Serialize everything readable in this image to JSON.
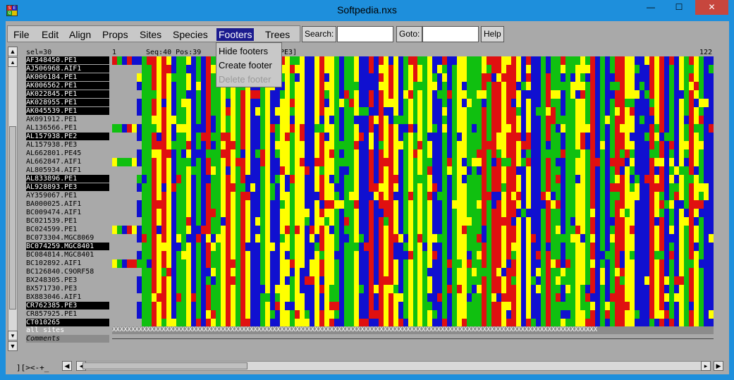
{
  "window": {
    "title": "Softpedia.nxs",
    "minimize": "—",
    "maximize": "☐",
    "close": "✕"
  },
  "app_icon_letters": [
    "S",
    "E",
    "Q",
    ""
  ],
  "menubar": [
    "File",
    "Edit",
    "Align",
    "Props",
    "Sites",
    "Species",
    "Footers",
    "Trees"
  ],
  "toolbar": {
    "search_label": "Search:",
    "search_value": "",
    "goto_label": "Goto:",
    "goto_value": "",
    "help_label": "Help"
  },
  "footers_menu": {
    "items": [
      {
        "label": "Hide footers",
        "enabled": true
      },
      {
        "label": "Create footer",
        "enabled": true
      },
      {
        "label": "Delete footer",
        "enabled": false
      }
    ]
  },
  "header": {
    "sel": "sel=30",
    "start": "1",
    "seq_pos": "Seq:40 Pos:39",
    "tail": "PE3]",
    "end": "122"
  },
  "sequences": [
    {
      "name": "AF348450.PE1",
      "selected": true
    },
    {
      "name": "AJ506968.AIF1",
      "selected": true
    },
    {
      "name": "AK006184.PE1",
      "selected": true
    },
    {
      "name": "AK006562.PE1",
      "selected": true
    },
    {
      "name": "AK022845.PE1",
      "selected": true
    },
    {
      "name": "AK028955.PE1",
      "selected": true
    },
    {
      "name": "AK045539.PE1",
      "selected": true
    },
    {
      "name": "AK091912.PE1",
      "selected": false
    },
    {
      "name": "AL136566.PE1",
      "selected": false
    },
    {
      "name": "AL157938.PE2",
      "selected": true
    },
    {
      "name": "AL157938.PE3",
      "selected": false
    },
    {
      "name": "AL662801.PE45",
      "selected": false
    },
    {
      "name": "AL662847.AIF1",
      "selected": false
    },
    {
      "name": "AL805934.AIF1",
      "selected": false
    },
    {
      "name": "AL833896.PE1",
      "selected": true
    },
    {
      "name": "AL928893.PE3",
      "selected": true
    },
    {
      "name": "AY359067.PE1",
      "selected": false
    },
    {
      "name": "BA000025.AIF1",
      "selected": false
    },
    {
      "name": "BC009474.AIF1",
      "selected": false
    },
    {
      "name": "BC021539.PE1",
      "selected": false
    },
    {
      "name": "BC024599.PE1",
      "selected": false
    },
    {
      "name": "BC073304.MGC8069",
      "selected": false
    },
    {
      "name": "BC074259.MGC8401",
      "selected": true
    },
    {
      "name": "BC084814.MGC8401",
      "selected": false
    },
    {
      "name": "BC102892.AIF1",
      "selected": false
    },
    {
      "name": "BC126840.C9ORF58",
      "selected": false
    },
    {
      "name": "BX248305.PE3",
      "selected": false
    },
    {
      "name": "BX571730.PE3",
      "selected": false
    },
    {
      "name": "BX883046.AIF1",
      "selected": false
    },
    {
      "name": "CR762385.PE3",
      "selected": true
    },
    {
      "name": "CR857925.PE1",
      "selected": false
    },
    {
      "name": "CT010265",
      "selected": true
    }
  ],
  "sites_row": {
    "label": "all sites",
    "pattern": "XXXXXXXXXXXXXXXXXXXXXXXXXXXXXXXXXXXXXXXXXXXXXXXXXXXXXXXXXXXXXXXXXXXXXXXXXXXXXXXXXXXXXXXXXXXXXXXXXXXXXXXXXXXXXXXXXXXXXXXXXXXXXXX"
  },
  "comments_label": "Comments",
  "status": "][><-+_",
  "colors": {
    "A": "#e01010",
    "C": "#1010d0",
    "G": "#ffff00",
    "T": "#10c010",
    "gap": "#a9a9a9"
  }
}
